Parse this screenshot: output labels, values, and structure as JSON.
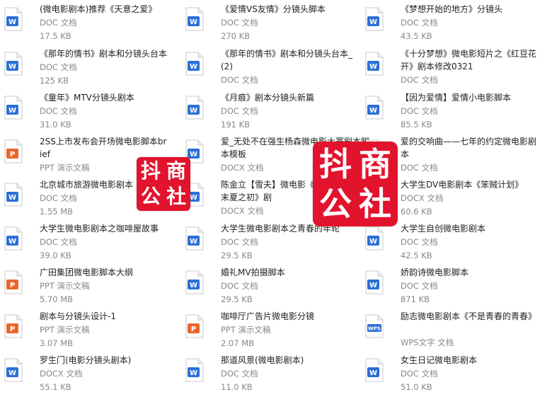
{
  "files": [
    {
      "name": "(微电影剧本)推荐《天意之爱》",
      "type": "DOC 文档",
      "size": "17.5 KB",
      "icon": "doc"
    },
    {
      "name": "《爱情VS友情》分镜头脚本",
      "type": "DOC 文档",
      "size": "270 KB",
      "icon": "doc"
    },
    {
      "name": "《梦想开始的地方》分镜头",
      "type": "DOC 文档",
      "size": "43.5 KB",
      "icon": "doc"
    },
    {
      "name": "《那年的情书》剧本和分镜头台本",
      "type": "DOC 文档",
      "size": "125 KB",
      "icon": "doc"
    },
    {
      "name": "《那年的情书》剧本和分镜头台本_(2)",
      "type": "DOC 文档",
      "size": "",
      "icon": "doc"
    },
    {
      "name": "《十分梦想》微电影短片之《红豆花开》剧本修改0321",
      "type": "DOC 文档",
      "size": "",
      "icon": "doc"
    },
    {
      "name": "《童年》MTV分镜头剧本",
      "type": "DOC 文档",
      "size": "31.0 KB",
      "icon": "doc"
    },
    {
      "name": "《月痕》剧本分镜头新篇",
      "type": "DOC 文档",
      "size": "191 KB",
      "icon": "doc"
    },
    {
      "name": "【因为爱情】爱情小电影脚本",
      "type": "DOC 文档",
      "size": "85.5 KB",
      "icon": "doc"
    },
    {
      "name": "2SS上市发布会开场微电影脚本brief",
      "type": "PPT 演示文稿",
      "size": "",
      "icon": "ppt"
    },
    {
      "name": "爱_无处不在强生杨森微电影大赛剧本脚本模板",
      "type": "DOCX 文档",
      "size": "",
      "icon": "docx"
    },
    {
      "name": "爱的交响曲——七年的约定微电影剧本",
      "type": "DOC 文档",
      "size": "",
      "icon": "doc"
    },
    {
      "name": "北京城市旅游微电影剧本",
      "type": "DOC 文档",
      "size": "1.55 MB",
      "icon": "doc"
    },
    {
      "name": "陈金立【雪夫】微电影《系列之春之末夏之初》剧",
      "type": "DOCX 文档",
      "size": "",
      "icon": "doc"
    },
    {
      "name": "大学生DV电影剧本《笨贼计划》",
      "type": "DOCX 文档",
      "size": "60.6 KB",
      "icon": "doc"
    },
    {
      "name": "大学生微电影剧本之咖啡屋故事",
      "type": "DOC 文档",
      "size": "39.0 KB",
      "icon": "doc"
    },
    {
      "name": "大学生微电影剧本之青春的年轮",
      "type": "DOC 文档",
      "size": "29.5 KB",
      "icon": "doc"
    },
    {
      "name": "大学生自创微电影剧本",
      "type": "DOC 文档",
      "size": "42.5 KB",
      "icon": "doc"
    },
    {
      "name": "广田集团微电影脚本大纲",
      "type": "PPT 演示文稿",
      "size": "5.70 MB",
      "icon": "ppt"
    },
    {
      "name": "婚礼MV拍摄脚本",
      "type": "DOC 文档",
      "size": "29.5 KB",
      "icon": "doc"
    },
    {
      "name": "娇韵诗微电影脚本",
      "type": "DOC 文档",
      "size": "871 KB",
      "icon": "doc"
    },
    {
      "name": "剧本与分镜头设计-1",
      "type": "PPT 演示文稿",
      "size": "3.07 MB",
      "icon": "ppt"
    },
    {
      "name": "咖啡厅广告片微电影分镜",
      "type": "PPT 演示文稿",
      "size": "2.07 MB",
      "icon": "ppt"
    },
    {
      "name": "励志微电影剧本《不是青春的青春》",
      "type": "WPS文字 文档",
      "size": "",
      "icon": "wps"
    },
    {
      "name": "罗生门(电影分镜头剧本)",
      "type": "DOCX 文档",
      "size": "55.1 KB",
      "icon": "docx"
    },
    {
      "name": "那道风景(微电影剧本)",
      "type": "DOC 文档",
      "size": "11.0 KB",
      "icon": "doc"
    },
    {
      "name": "女生日记微电影剧本",
      "type": "DOC 文档",
      "size": "51.0 KB",
      "icon": "doc"
    }
  ],
  "watermark": {
    "chars": [
      "抖",
      "商",
      "公",
      "社"
    ],
    "color": "#e2132d"
  },
  "colors": {
    "doc": "#2b6fd6",
    "docx": "#2b6fd6",
    "ppt": "#e8662c",
    "wps": "#2b6fd6"
  }
}
